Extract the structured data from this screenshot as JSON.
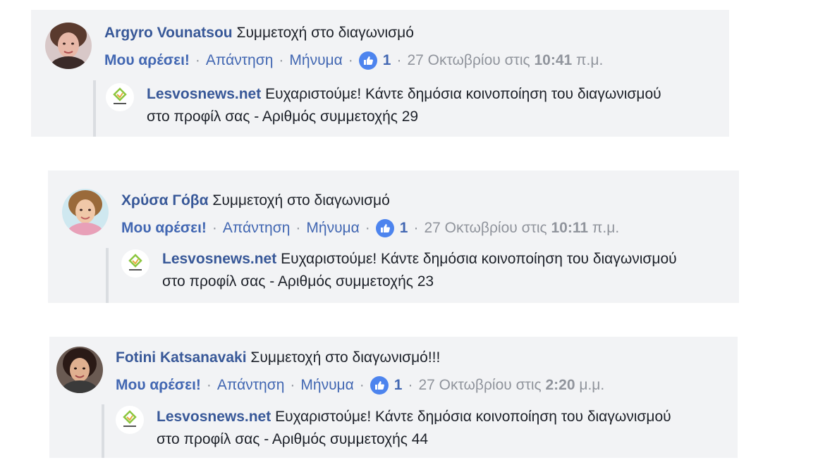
{
  "comments": [
    {
      "author": "Argyro Vounatsou",
      "text": "Συμμετοχή στο διαγωνισμό",
      "actions": {
        "like": "Μου αρέσει!",
        "reply": "Απάντηση",
        "message": "Μήνυμα",
        "like_count": "1",
        "date_prefix": "27 Οκτωβρίου στις",
        "time": "10:41",
        "ampm": "π.μ."
      },
      "reply": {
        "author": "Lesvosnews.net",
        "text": "Ευχαριστούμε! Κάντε δημόσια κοινοποίηση του διαγωνισμού στο προφίλ σας - Αριθμός συμμετοχής 29"
      }
    },
    {
      "author": "Χρύσα Γόβα",
      "text": "Συμμετοχή στο διαγωνισμό",
      "actions": {
        "like": "Μου αρέσει!",
        "reply": "Απάντηση",
        "message": "Μήνυμα",
        "like_count": "1",
        "date_prefix": "27 Οκτωβρίου στις",
        "time": "10:11",
        "ampm": "π.μ."
      },
      "reply": {
        "author": "Lesvosnews.net",
        "text": "Ευχαριστούμε! Κάντε δημόσια κοινοποίηση του διαγωνισμού στο προφίλ σας - Αριθμός συμμετοχής 23"
      }
    },
    {
      "author": "Fotini Katsanavaki",
      "text": "Συμμετοχή στο διαγωνισμό!!!",
      "actions": {
        "like": "Μου αρέσει!",
        "reply": "Απάντηση",
        "message": "Μήνυμα",
        "like_count": "1",
        "date_prefix": "27 Οκτωβρίου στις",
        "time": "2:20",
        "ampm": "μ.μ."
      },
      "reply": {
        "author": "Lesvosnews.net",
        "text": "Ευχαριστούμε! Κάντε δημόσια κοινοποίηση του διαγωνισμού στο προφίλ σας - Αριθμός συμμετοχής 44"
      }
    }
  ],
  "separator": "·",
  "icons": {
    "like_badge": "thumbs-up-icon",
    "avatar": "profile-photo",
    "page_logo": "lesvosnews-logo"
  },
  "colors": {
    "card_bg": "#f2f3f5",
    "link": "#4267b2",
    "author": "#385898",
    "meta": "#90949c",
    "like_badge": "#4d84ee"
  }
}
